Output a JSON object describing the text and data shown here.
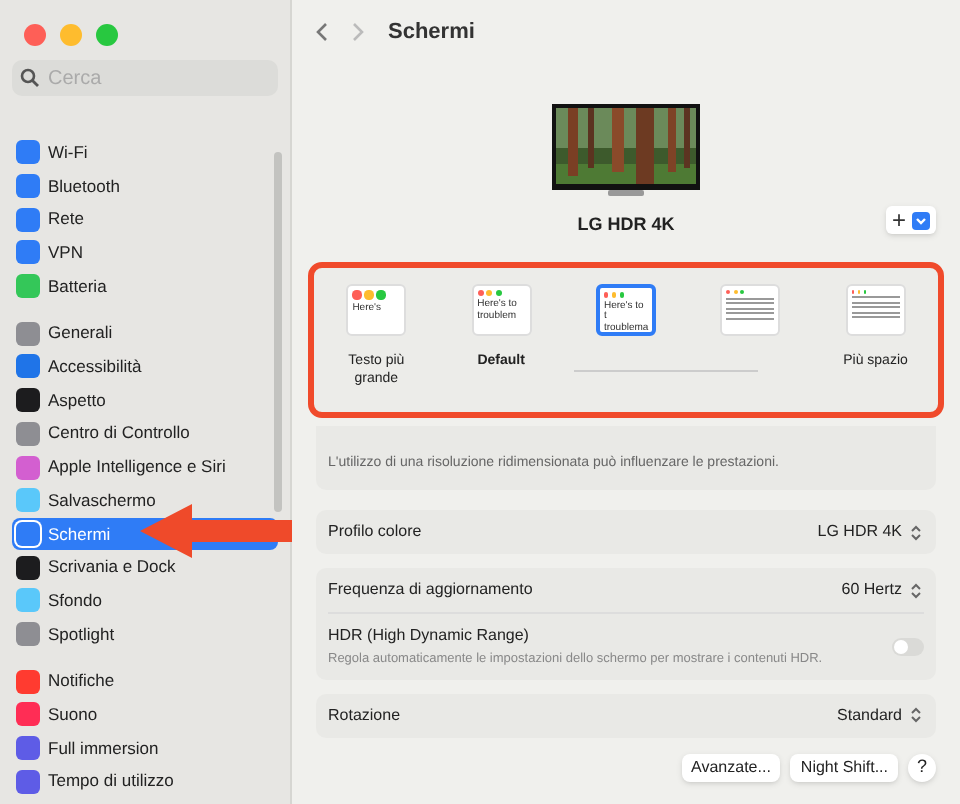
{
  "window": {
    "title": "Schermi"
  },
  "search": {
    "placeholder": "Cerca"
  },
  "sidebar": {
    "groups": [
      [
        {
          "label": "Wi-Fi",
          "color": "#2f7cf6",
          "selected": false
        },
        {
          "label": "Bluetooth",
          "color": "#2f7cf6",
          "selected": false
        },
        {
          "label": "Rete",
          "color": "#2f7cf6",
          "selected": false
        },
        {
          "label": "VPN",
          "color": "#2f7cf6",
          "selected": false
        },
        {
          "label": "Batteria",
          "color": "#34c759",
          "selected": false
        }
      ],
      [
        {
          "label": "Generali",
          "color": "#8e8e93",
          "selected": false
        },
        {
          "label": "Accessibilità",
          "color": "#1f74e8",
          "selected": false
        },
        {
          "label": "Aspetto",
          "color": "#1c1c1e",
          "selected": false
        },
        {
          "label": "Centro di Controllo",
          "color": "#8e8e93",
          "selected": false
        },
        {
          "label": "Apple Intelligence e Siri",
          "color": "#d35fd0",
          "selected": false
        },
        {
          "label": "Salvaschermo",
          "color": "#5ac8fa",
          "selected": false
        },
        {
          "label": "Schermi",
          "color": "#2f7cf6",
          "selected": true
        },
        {
          "label": "Scrivania e Dock",
          "color": "#1c1c1e",
          "selected": false
        },
        {
          "label": "Sfondo",
          "color": "#5ac8fa",
          "selected": false
        },
        {
          "label": "Spotlight",
          "color": "#8e8e93",
          "selected": false
        }
      ],
      [
        {
          "label": "Notifiche",
          "color": "#ff3b30",
          "selected": false
        },
        {
          "label": "Suono",
          "color": "#ff2d55",
          "selected": false
        },
        {
          "label": "Full immersion",
          "color": "#5e5ce6",
          "selected": false
        },
        {
          "label": "Tempo di utilizzo",
          "color": "#5e5ce6",
          "selected": false
        }
      ]
    ]
  },
  "display": {
    "name": "LG HDR 4K"
  },
  "resolutions": [
    {
      "label": "Testo più grande",
      "preview": "Here's",
      "selected": false
    },
    {
      "label": "Default",
      "preview": "Here's to troublem",
      "selected": false
    },
    {
      "preview": "Here's to t troublema",
      "selected": true
    },
    {
      "selected": false
    },
    {
      "label": "Più spazio",
      "selected": false
    }
  ],
  "note": "L'utilizzo di una risoluzione ridimensionata può influenzare le prestazioni.",
  "groups": [
    [
      {
        "kind": "popup",
        "label": "Profilo colore",
        "value": "LG HDR 4K"
      }
    ],
    [
      {
        "kind": "popup",
        "label": "Frequenza di aggiornamento",
        "value": "60 Hertz"
      },
      {
        "kind": "toggle",
        "label": "HDR (High Dynamic Range)",
        "description": "Regola automaticamente le impostazioni dello schermo per mostrare i contenuti HDR.",
        "on": false
      }
    ],
    [
      {
        "kind": "popup",
        "label": "Rotazione",
        "value": "Standard"
      }
    ]
  ],
  "buttons": [
    "Avanzate...",
    "Night Shift..."
  ],
  "help": "?",
  "add_button": "+"
}
